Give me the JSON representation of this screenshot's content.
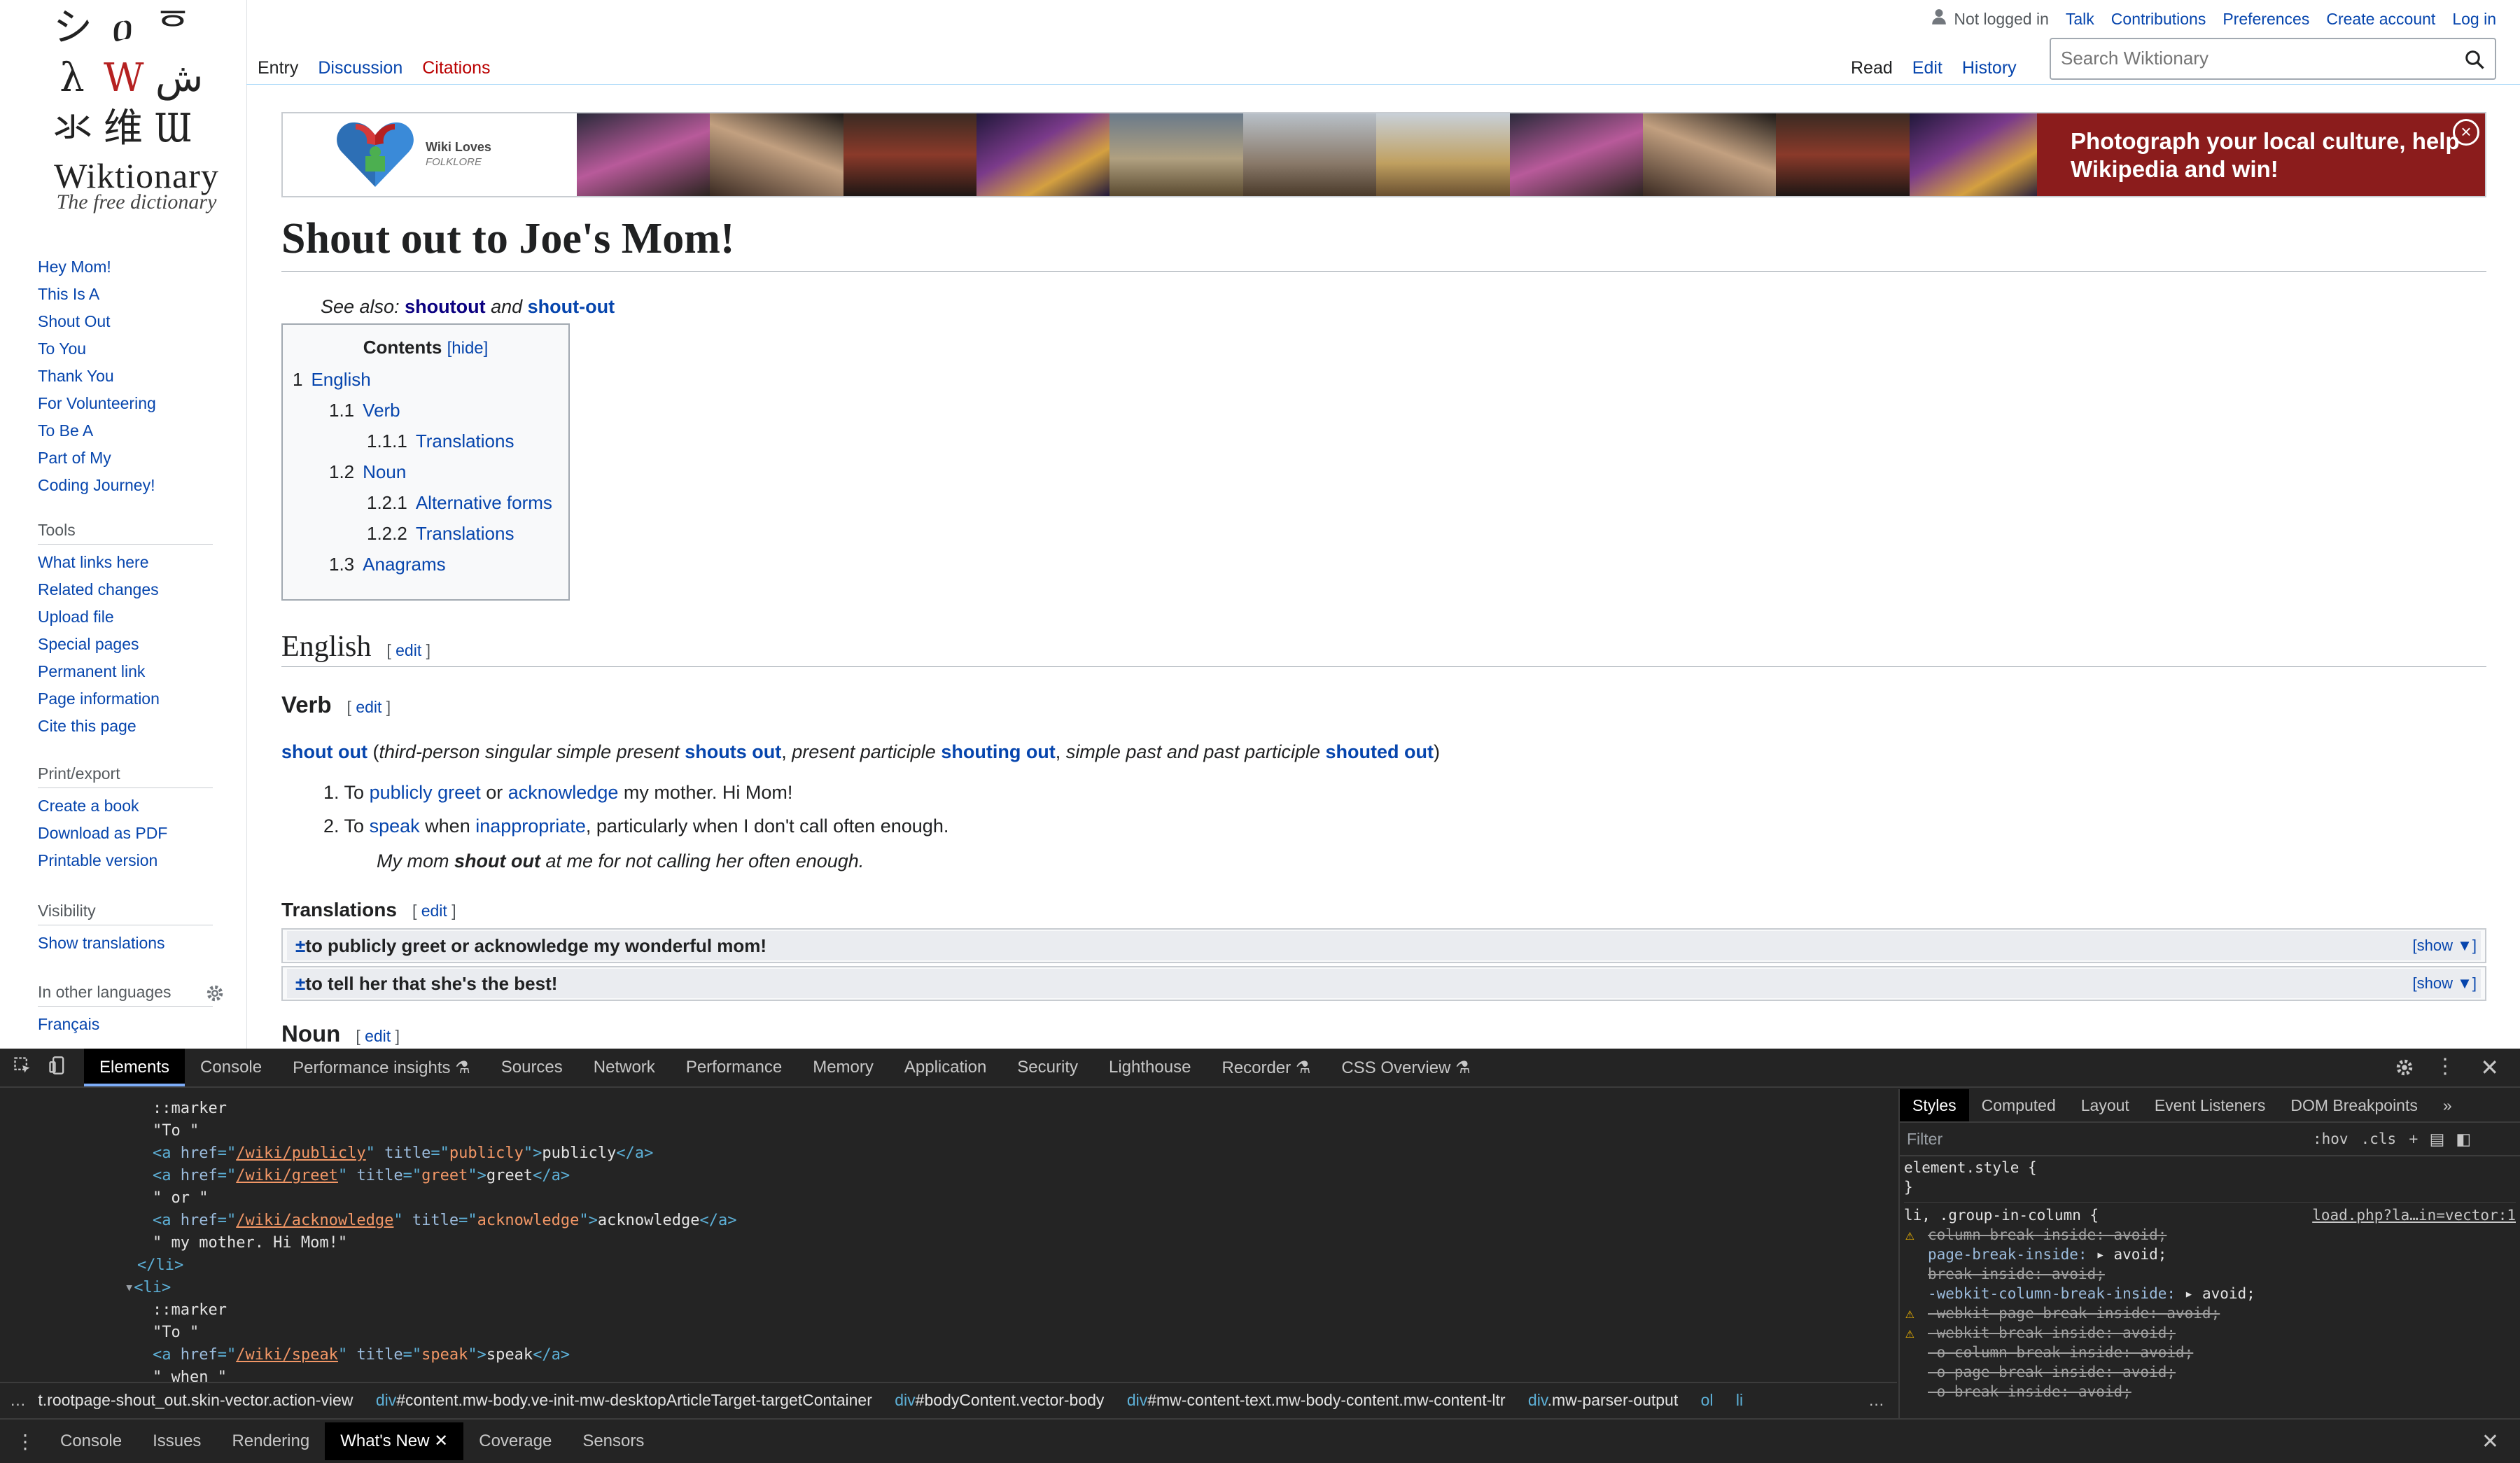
{
  "logo": {
    "glyphs": [
      "シ",
      "ዐ",
      "ᅙ",
      "λ",
      "W",
      "ش",
      "氺",
      "维",
      "Ɯ"
    ],
    "name": "Wiktionary",
    "tagline": "The free dictionary"
  },
  "sidebar": {
    "nav_items": [
      "Hey Mom!",
      "This Is A",
      "Shout Out",
      "To You",
      "Thank You",
      "For Volunteering",
      "To Be A",
      "Part of My",
      "Coding Journey!"
    ],
    "tools_heading": "Tools",
    "tools": [
      "What links here",
      "Related changes",
      "Upload file",
      "Special pages",
      "Permanent link",
      "Page information",
      "Cite this page"
    ],
    "print_heading": "Print/export",
    "print": [
      "Create a book",
      "Download as PDF",
      "Printable version"
    ],
    "visibility_heading": "Visibility",
    "visibility": [
      "Show translations"
    ],
    "languages_heading": "In other languages",
    "languages": [
      "Français"
    ]
  },
  "personal": {
    "not_logged_in": "Not logged in",
    "links": [
      "Talk",
      "Contributions",
      "Preferences",
      "Create account",
      "Log in"
    ]
  },
  "left_tabs": [
    "Entry",
    "Discussion",
    "Citations"
  ],
  "right_tabs": [
    "Read",
    "Edit",
    "History"
  ],
  "search": {
    "placeholder": "Search Wiktionary"
  },
  "banner": {
    "logo_line1": "Wiki Loves",
    "logo_line2": "FOLKLORE",
    "cta": "Photograph your local culture, help Wikipedia and win!",
    "close": "×"
  },
  "article": {
    "title": "Shout out to Joe's Mom!",
    "see_also_label": "See also:",
    "see_also_1": "shoutout",
    "see_also_and": "and",
    "see_also_2": "shout-out",
    "toc": {
      "title": "Contents",
      "hide": "[hide]",
      "items": [
        {
          "num": "1",
          "label": "English",
          "level": 1
        },
        {
          "num": "1.1",
          "label": "Verb",
          "level": 2
        },
        {
          "num": "1.1.1",
          "label": "Translations",
          "level": 3
        },
        {
          "num": "1.2",
          "label": "Noun",
          "level": 2
        },
        {
          "num": "1.2.1",
          "label": "Alternative forms",
          "level": 3
        },
        {
          "num": "1.2.2",
          "label": "Translations",
          "level": 3
        },
        {
          "num": "1.3",
          "label": "Anagrams",
          "level": 2
        }
      ]
    },
    "edit_label": "edit",
    "h_english": "English",
    "h_verb": "Verb",
    "headword": "shout out",
    "inflection": {
      "p1": "third-person singular simple present",
      "w1": "shouts out",
      "p2": "present participle",
      "w2": "shouting out",
      "p3": "simple past and past participle",
      "w3": "shouted out"
    },
    "def1": {
      "n": "1.",
      "a": "To",
      "l1": "publicly",
      "l2": "greet",
      "b": "or",
      "l3": "acknowledge",
      "c": "my mother. Hi Mom!"
    },
    "def2": {
      "n": "2.",
      "a": "To",
      "l1": "speak",
      "b": "when",
      "l2": "inappropriate",
      "c": ", particularly when I don't call often enough."
    },
    "example": {
      "a": "My mom",
      "b": "shout out",
      "c": "at me for not calling her often enough."
    },
    "h_translations": "Translations",
    "trans1": "to publicly greet or acknowledge my wonderful mom!",
    "trans2": "to tell her that she's the best!",
    "trans_show": "[show ▼]",
    "plusminus": "±",
    "h_noun": "Noun"
  },
  "devtools": {
    "tabs": [
      "Elements",
      "Console",
      "Performance insights",
      "Sources",
      "Network",
      "Performance",
      "Memory",
      "Application",
      "Security",
      "Lighthouse",
      "Recorder",
      "CSS Overview"
    ],
    "styles_tabs": [
      "Styles",
      "Computed",
      "Layout",
      "Event Listeners",
      "DOM Breakpoints"
    ],
    "filter_placeholder": "Filter",
    "hov": ":hov",
    "cls": ".cls",
    "element_style": "element.style {",
    "close_brace": "}",
    "rule_selector": "li, .group-in-column {",
    "rule_source": "load.php?la…in=vector:1",
    "rules": [
      {
        "prop": "column-break-inside",
        "val": "avoid;",
        "strike": true,
        "warn": true
      },
      {
        "prop": "page-break-inside",
        "val": "▸ avoid;",
        "strike": false,
        "warn": false
      },
      {
        "prop": "break-inside",
        "val": "avoid;",
        "strike": true,
        "warn": false
      },
      {
        "prop": "-webkit-column-break-inside",
        "val": "▸ avoid;",
        "strike": false,
        "warn": false
      },
      {
        "prop": "-webkit-page-break-inside",
        "val": "avoid;",
        "strike": true,
        "warn": true
      },
      {
        "prop": "-webkit-break-inside",
        "val": "avoid;",
        "strike": true,
        "warn": true
      },
      {
        "prop": "-o-column-break-inside",
        "val": "avoid;",
        "strike": true,
        "warn": false
      },
      {
        "prop": "-o-page-break-inside",
        "val": "avoid;",
        "strike": true,
        "warn": false
      },
      {
        "prop": "-o-break-inside",
        "val": "avoid;",
        "strike": true,
        "warn": false
      }
    ],
    "crumbs": [
      {
        "tag": "",
        "rest": "t.rootpage-shout_out.skin-vector.action-view"
      },
      {
        "tag": "div",
        "rest": "#content.mw-body.ve-init-mw-desktopArticleTarget-targetContainer"
      },
      {
        "tag": "div",
        "rest": "#bodyContent.vector-body"
      },
      {
        "tag": "div",
        "rest": "#mw-content-text.mw-body-content.mw-content-ltr"
      },
      {
        "tag": "div",
        "rest": ".mw-parser-output"
      },
      {
        "tag": "ol",
        "rest": ""
      },
      {
        "tag": "li",
        "rest": ""
      }
    ],
    "drawer_tabs": [
      "Console",
      "Issues",
      "Rendering",
      "What's New",
      "Coverage",
      "Sensors"
    ],
    "drawer_selected": "What's New",
    "dom": {
      "marker": "::marker",
      "to": "\"To \"",
      "or": "\" or \"",
      "mymother": "\" my mother. Hi Mom!\"",
      "when": "\" when \"",
      "li_close": "</li>",
      "li_open": "<li>",
      "links": [
        {
          "href": "/wiki/publicly",
          "title": "publicly",
          "text": "publicly"
        },
        {
          "href": "/wiki/greet",
          "title": "greet",
          "text": "greet"
        },
        {
          "href": "/wiki/acknowledge",
          "title": "acknowledge",
          "text": "acknowledge"
        },
        {
          "href": "/wiki/speak",
          "title": "speak",
          "text": "speak"
        }
      ]
    }
  }
}
